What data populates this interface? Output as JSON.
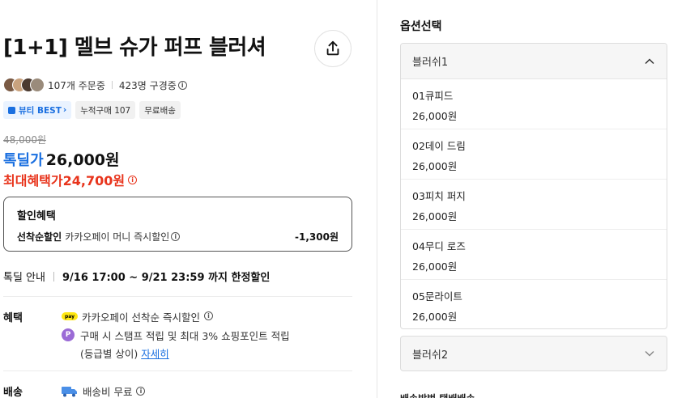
{
  "product": {
    "title": "[1+1] 멜브 슈가 퍼프 블러셔",
    "orders": "107개 주문중",
    "subscribers": "423명 구경중",
    "badges": [
      "뷰티 BEST",
      "누적구매 107",
      "무료배송"
    ],
    "original_price": "48,000원",
    "deal_name": "톡딜가",
    "deal_price": "26,000원",
    "max_benefit_label": "최대혜택가",
    "max_benefit_price": "24,700원"
  },
  "discount": {
    "title": "할인혜택",
    "label": "선착순할인",
    "desc": "카카오페이 머니 즉시할인",
    "amount": "-1,300원"
  },
  "tokdeal": {
    "label": "톡딜 안내",
    "period": "9/16 17:00 ~ 9/21 23:59 까지 한정할인"
  },
  "benefits": {
    "label": "혜택",
    "pay_text": "카카오페이 선착순 즉시할인",
    "pay_icon_text": "pay",
    "point_icon_text": "P",
    "point_text": "구매 시 스탬프 적립 및 최대 3% 쇼핑포인트 적립",
    "point_text2": "(등급별 상이)",
    "point_link": "자세히"
  },
  "shipping": {
    "label": "배송",
    "text": "배송비 무료"
  },
  "options": {
    "title": "옵션선택",
    "group1": "블러쉬1",
    "group2": "블러쉬2",
    "items": [
      {
        "name": "01큐피드",
        "price": "26,000원"
      },
      {
        "name": "02데이 드림",
        "price": "26,000원"
      },
      {
        "name": "03피치 퍼지",
        "price": "26,000원"
      },
      {
        "name": "04무디 로즈",
        "price": "26,000원"
      },
      {
        "name": "05문라이트",
        "price": "26,000원"
      }
    ],
    "cutoff_text": "배송방법 택배배송"
  },
  "colors": {
    "deal_blue": "#1a6fe0",
    "benefit_red": "#e8341c",
    "kakao_yellow": "#ffe812"
  }
}
